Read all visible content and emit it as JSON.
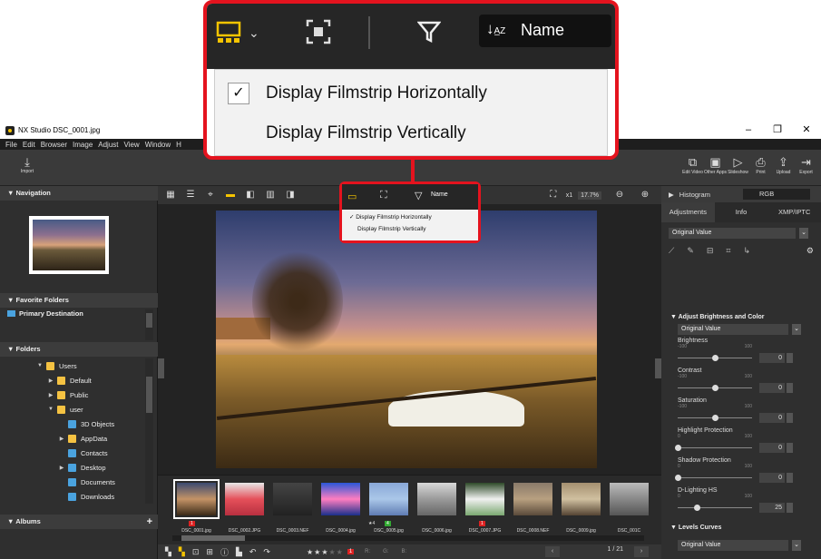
{
  "window": {
    "title": "NX Studio   DSC_0001.jpg",
    "minimize": "–",
    "restore": "❐",
    "close": "✕"
  },
  "menu": [
    "File",
    "Edit",
    "Browser",
    "Image",
    "Adjust",
    "View",
    "Window",
    "H"
  ],
  "toolbar": {
    "import_label": "Import",
    "right_buttons": [
      {
        "label": "Edit Video",
        "icon": "edit-video-icon",
        "glyph": "⧉"
      },
      {
        "label": "Other Apps",
        "icon": "other-apps-icon",
        "glyph": "▣"
      },
      {
        "label": "Slideshow",
        "icon": "slideshow-icon",
        "glyph": "▷"
      },
      {
        "label": "Print",
        "icon": "print-icon",
        "glyph": "⎙"
      },
      {
        "label": "Upload",
        "icon": "upload-icon",
        "glyph": "⇪"
      },
      {
        "label": "Export",
        "icon": "export-icon",
        "glyph": "⇥"
      }
    ]
  },
  "sidebar": {
    "navigation": "Navigation",
    "favorites": "Favorite Folders",
    "primary_destination": "Primary Destination",
    "folders": "Folders",
    "albums": "Albums",
    "add": "+",
    "tree": [
      {
        "label": "Users",
        "indent": 40,
        "arrow": "▼",
        "color": "yellow"
      },
      {
        "label": "Default",
        "indent": 52,
        "arrow": "▶",
        "color": "yellow"
      },
      {
        "label": "Public",
        "indent": 52,
        "arrow": "▶",
        "color": "yellow"
      },
      {
        "label": "user",
        "indent": 52,
        "arrow": "▼",
        "color": "yellow"
      },
      {
        "label": "3D Objects",
        "indent": 64,
        "arrow": "",
        "color": "blue"
      },
      {
        "label": "AppData",
        "indent": 64,
        "arrow": "▶",
        "color": "yellow"
      },
      {
        "label": "Contacts",
        "indent": 64,
        "arrow": "",
        "color": "blue"
      },
      {
        "label": "Desktop",
        "indent": 64,
        "arrow": "▶",
        "color": "blue"
      },
      {
        "label": "Documents",
        "indent": 64,
        "arrow": "",
        "color": "blue"
      },
      {
        "label": "Downloads",
        "indent": 64,
        "arrow": "",
        "color": "blue"
      }
    ]
  },
  "viewer": {
    "sort_label": "Name",
    "zoom_factor": "x1",
    "zoom_percent": "17.7%"
  },
  "filmstrip": {
    "thumbnails": [
      {
        "name": "DSC_0001.jpg",
        "colors": [
          "#3b4a70",
          "#c49366",
          "#3a2a18"
        ]
      },
      {
        "name": "DSC_0002.JPG",
        "colors": [
          "#e8e8e8",
          "#e5505a",
          "#b73040"
        ]
      },
      {
        "name": "DSC_0003.NEF",
        "colors": [
          "#444",
          "#333",
          "#222"
        ]
      },
      {
        "name": "DSC_0004.jpg",
        "colors": [
          "#2a57d8",
          "#ff7ec0",
          "#1a2f8a"
        ]
      },
      {
        "name": "DSC_0005.jpg",
        "colors": [
          "#8aa8d8",
          "#aac7e8",
          "#5f7cb3"
        ]
      },
      {
        "name": "DSC_0006.jpg",
        "colors": [
          "#d8d8d8",
          "#9a9a9a",
          "#666"
        ]
      },
      {
        "name": "DSC_0007.JPG",
        "colors": [
          "#2f4a2a",
          "#f0f0f0",
          "#7aa870"
        ]
      },
      {
        "name": "DSC_0008.NEF",
        "colors": [
          "#8a7a6a",
          "#b8a080",
          "#5a4a3a"
        ]
      },
      {
        "name": "DSC_0009.jpg",
        "colors": [
          "#a59070",
          "#d0c0a0",
          "#554433"
        ]
      },
      {
        "name": "DSC_001C",
        "colors": [
          "#bbb",
          "#888",
          "#555"
        ]
      }
    ],
    "badges": {
      "t1": "1",
      "t5_rating": "★4",
      "t5_label": "4",
      "t7": "1"
    }
  },
  "status": {
    "page": "1 / 21",
    "r": "R:",
    "g": "G:",
    "b": "B:",
    "rating_label": "1"
  },
  "right_panel": {
    "histogram": "Histogram",
    "rgb": "RGB",
    "tabs": [
      "Adjustments",
      "Info",
      "XMP/IPTC"
    ],
    "original_value": "Original Value",
    "adjust_section": "Adjust Brightness and Color",
    "sliders": [
      {
        "label": "Brightness",
        "min": "-100",
        "max": "100",
        "value": "0",
        "pos": 0.5
      },
      {
        "label": "Contrast",
        "min": "-100",
        "max": "100",
        "value": "0",
        "pos": 0.5
      },
      {
        "label": "Saturation",
        "min": "-100",
        "max": "100",
        "value": "0",
        "pos": 0.5
      },
      {
        "label": "Highlight Protection",
        "min": "0",
        "max": "100",
        "value": "0",
        "pos": 0.0
      },
      {
        "label": "Shadow Protection",
        "min": "0",
        "max": "100",
        "value": "0",
        "pos": 0.0
      },
      {
        "label": "D-Lighting HS",
        "min": "0",
        "max": "100",
        "value": "25",
        "pos": 0.25
      }
    ],
    "levels": "Levels Curves"
  },
  "callout": {
    "sort_label": "Name",
    "item1": "Display Filmstrip Horizontally",
    "item2": "Display Filmstrip Vertically",
    "check": "✓"
  },
  "colors": {
    "accent": "#f5c400",
    "highlight": "#e4131e"
  }
}
